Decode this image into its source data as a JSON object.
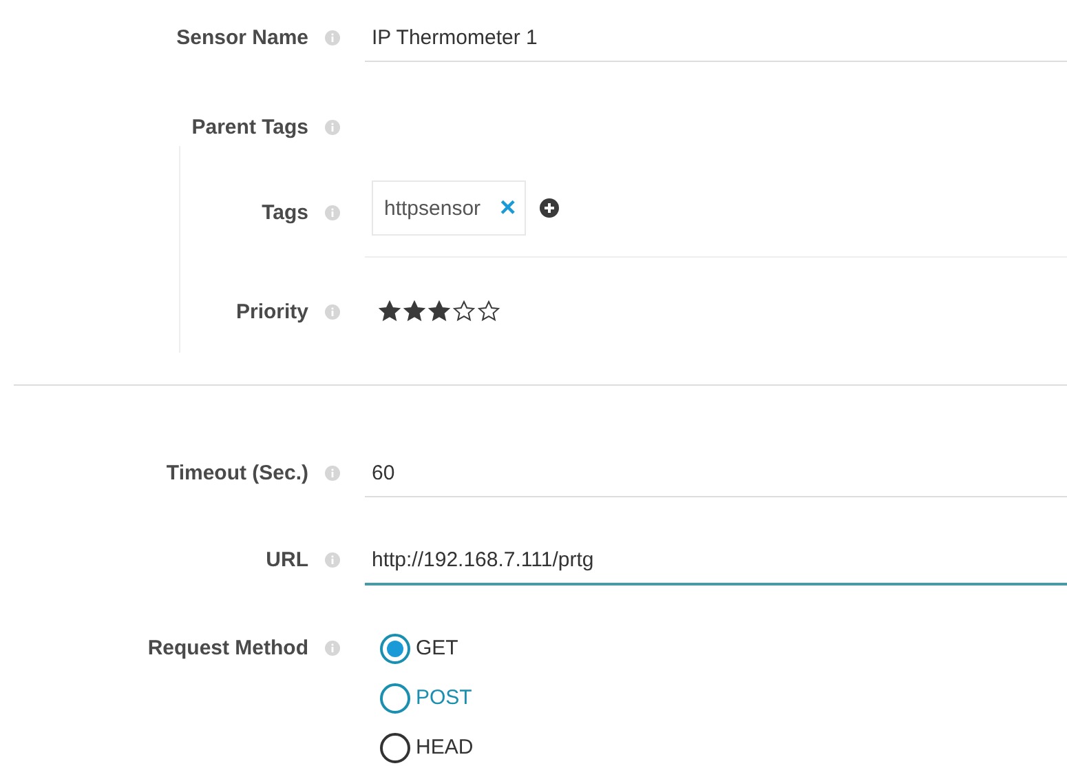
{
  "fields_top": [
    {
      "kind": "text",
      "label": "Sensor Name",
      "value": "IP Thermometer 1",
      "focused": false
    },
    {
      "kind": "empty",
      "label": "Parent Tags"
    }
  ],
  "tag_group": [
    {
      "kind": "tags",
      "label": "Tags",
      "tags": [
        {
          "text": "httpsensor",
          "remove": "×"
        }
      ]
    },
    {
      "kind": "stars",
      "label": "Priority",
      "stars": 3
    }
  ],
  "fields_bottom": [
    {
      "kind": "text",
      "label": "Timeout (Sec.)",
      "value": "60",
      "focused": false
    },
    {
      "kind": "text",
      "label": "URL",
      "value": "http://192.168.7.111/prtg",
      "focused": true
    },
    {
      "kind": "radio",
      "label": "Request Method",
      "options": [
        {
          "label": "GET",
          "selected": true,
          "highlighted": false
        },
        {
          "label": "POST",
          "selected": false,
          "highlighted": true
        },
        {
          "label": "HEAD",
          "selected": false,
          "highlighted": false
        }
      ]
    }
  ]
}
